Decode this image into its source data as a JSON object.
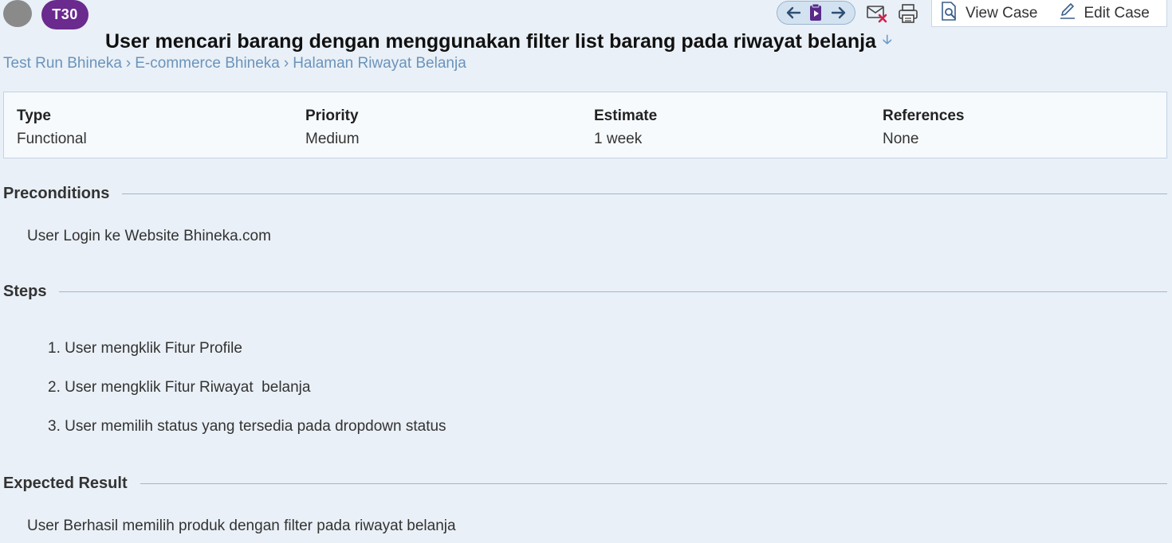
{
  "header": {
    "case_id": "T30",
    "title": "User mencari barang dengan menggunakan filter list barang pada riwayat belanja",
    "view_case_label": "View Case",
    "edit_case_label": "Edit Case"
  },
  "breadcrumb": {
    "items": [
      "Test Run Bhineka",
      "E-commerce Bhineka",
      "Halaman Riwayat Belanja"
    ],
    "separator": "›"
  },
  "info": {
    "type_label": "Type",
    "type_value": "Functional",
    "priority_label": "Priority",
    "priority_value": "Medium",
    "estimate_label": "Estimate",
    "estimate_value": "1 week",
    "references_label": "References",
    "references_value": "None"
  },
  "preconditions": {
    "heading": "Preconditions",
    "text": "User Login ke Website Bhineka.com"
  },
  "steps": {
    "heading": "Steps",
    "items": [
      "1. User mengklik Fitur Profile",
      "2. User mengklik Fitur Riwayat  belanja",
      "3. User memilih status yang tersedia pada dropdown status"
    ]
  },
  "expected": {
    "heading": "Expected Result",
    "text": "User Berhasil memilih produk dengan filter pada riwayat belanja"
  },
  "icons": {
    "status": "status-dot",
    "prev": "arrow-left-icon",
    "play": "clipboard-play-icon",
    "next": "arrow-right-icon",
    "unsubscribe": "mail-x-icon",
    "print": "printer-icon",
    "view": "document-search-icon",
    "edit": "pencil-icon"
  },
  "colors": {
    "badge": "#6a2a8e",
    "link": "#6b93bb",
    "accent": "#3a5f8a",
    "mail_x": "#d6204c"
  }
}
